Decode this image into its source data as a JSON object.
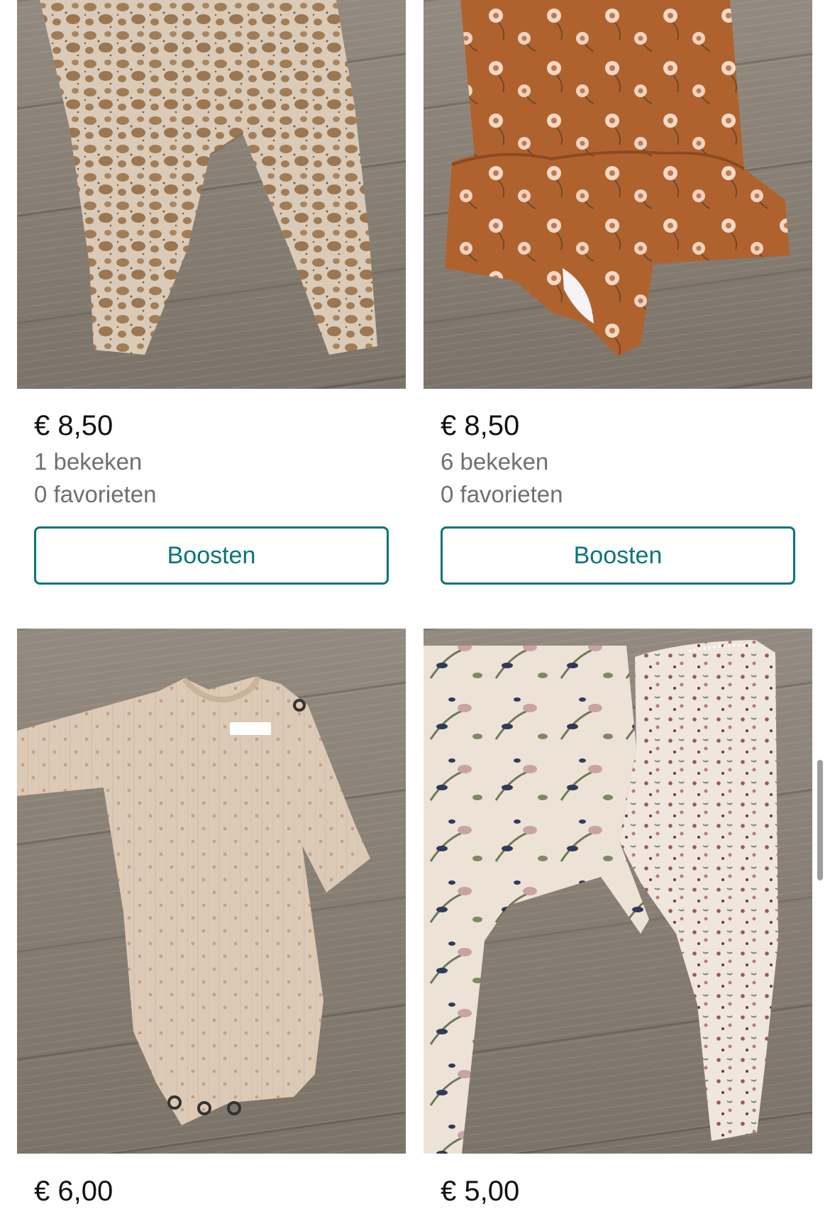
{
  "products": [
    {
      "price": "€ 8,50",
      "views": "1 bekeken",
      "favorites": "0 favorieten",
      "button_label": "Boosten"
    },
    {
      "price": "€ 8,50",
      "views": "6 bekeken",
      "favorites": "0 favorieten",
      "button_label": "Boosten"
    },
    {
      "price": "€ 6,00"
    },
    {
      "price": "€ 5,00"
    }
  ]
}
